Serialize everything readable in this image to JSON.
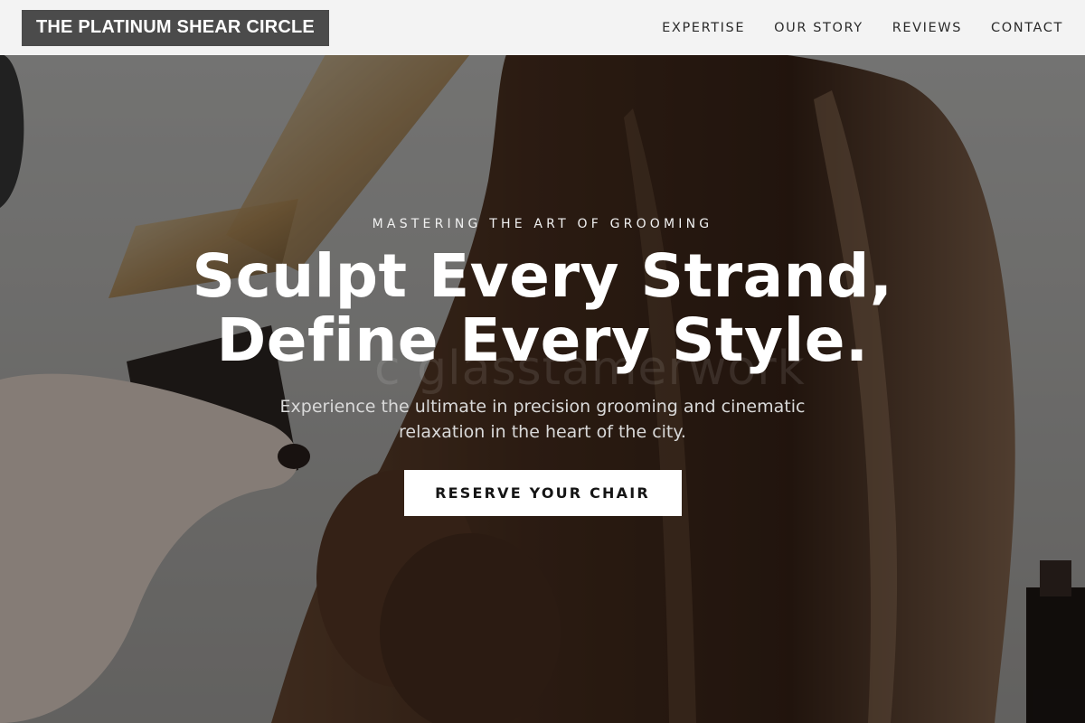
{
  "brand": {
    "name": "THE PLATINUM SHEAR CIRCLE"
  },
  "nav": {
    "items": [
      {
        "label": "EXPERTISE"
      },
      {
        "label": "OUR STORY"
      },
      {
        "label": "REVIEWS"
      },
      {
        "label": "CONTACT"
      }
    ]
  },
  "hero": {
    "eyebrow": "MASTERING THE ART OF GROOMING",
    "headline_line1": "Sculpt Every Strand,",
    "headline_line2": "Define Every Style.",
    "subtext": "Experience the ultimate in precision grooming and cinematic relaxation in the heart of the city.",
    "cta_label": "RESERVE YOUR CHAIR",
    "watermark": "c glasstamerwork"
  },
  "colors": {
    "navbar_bg": "#f3f3f3",
    "logo_bg": "#4b4b4b",
    "cta_bg": "#ffffff",
    "headline_text": "#ffffff"
  }
}
